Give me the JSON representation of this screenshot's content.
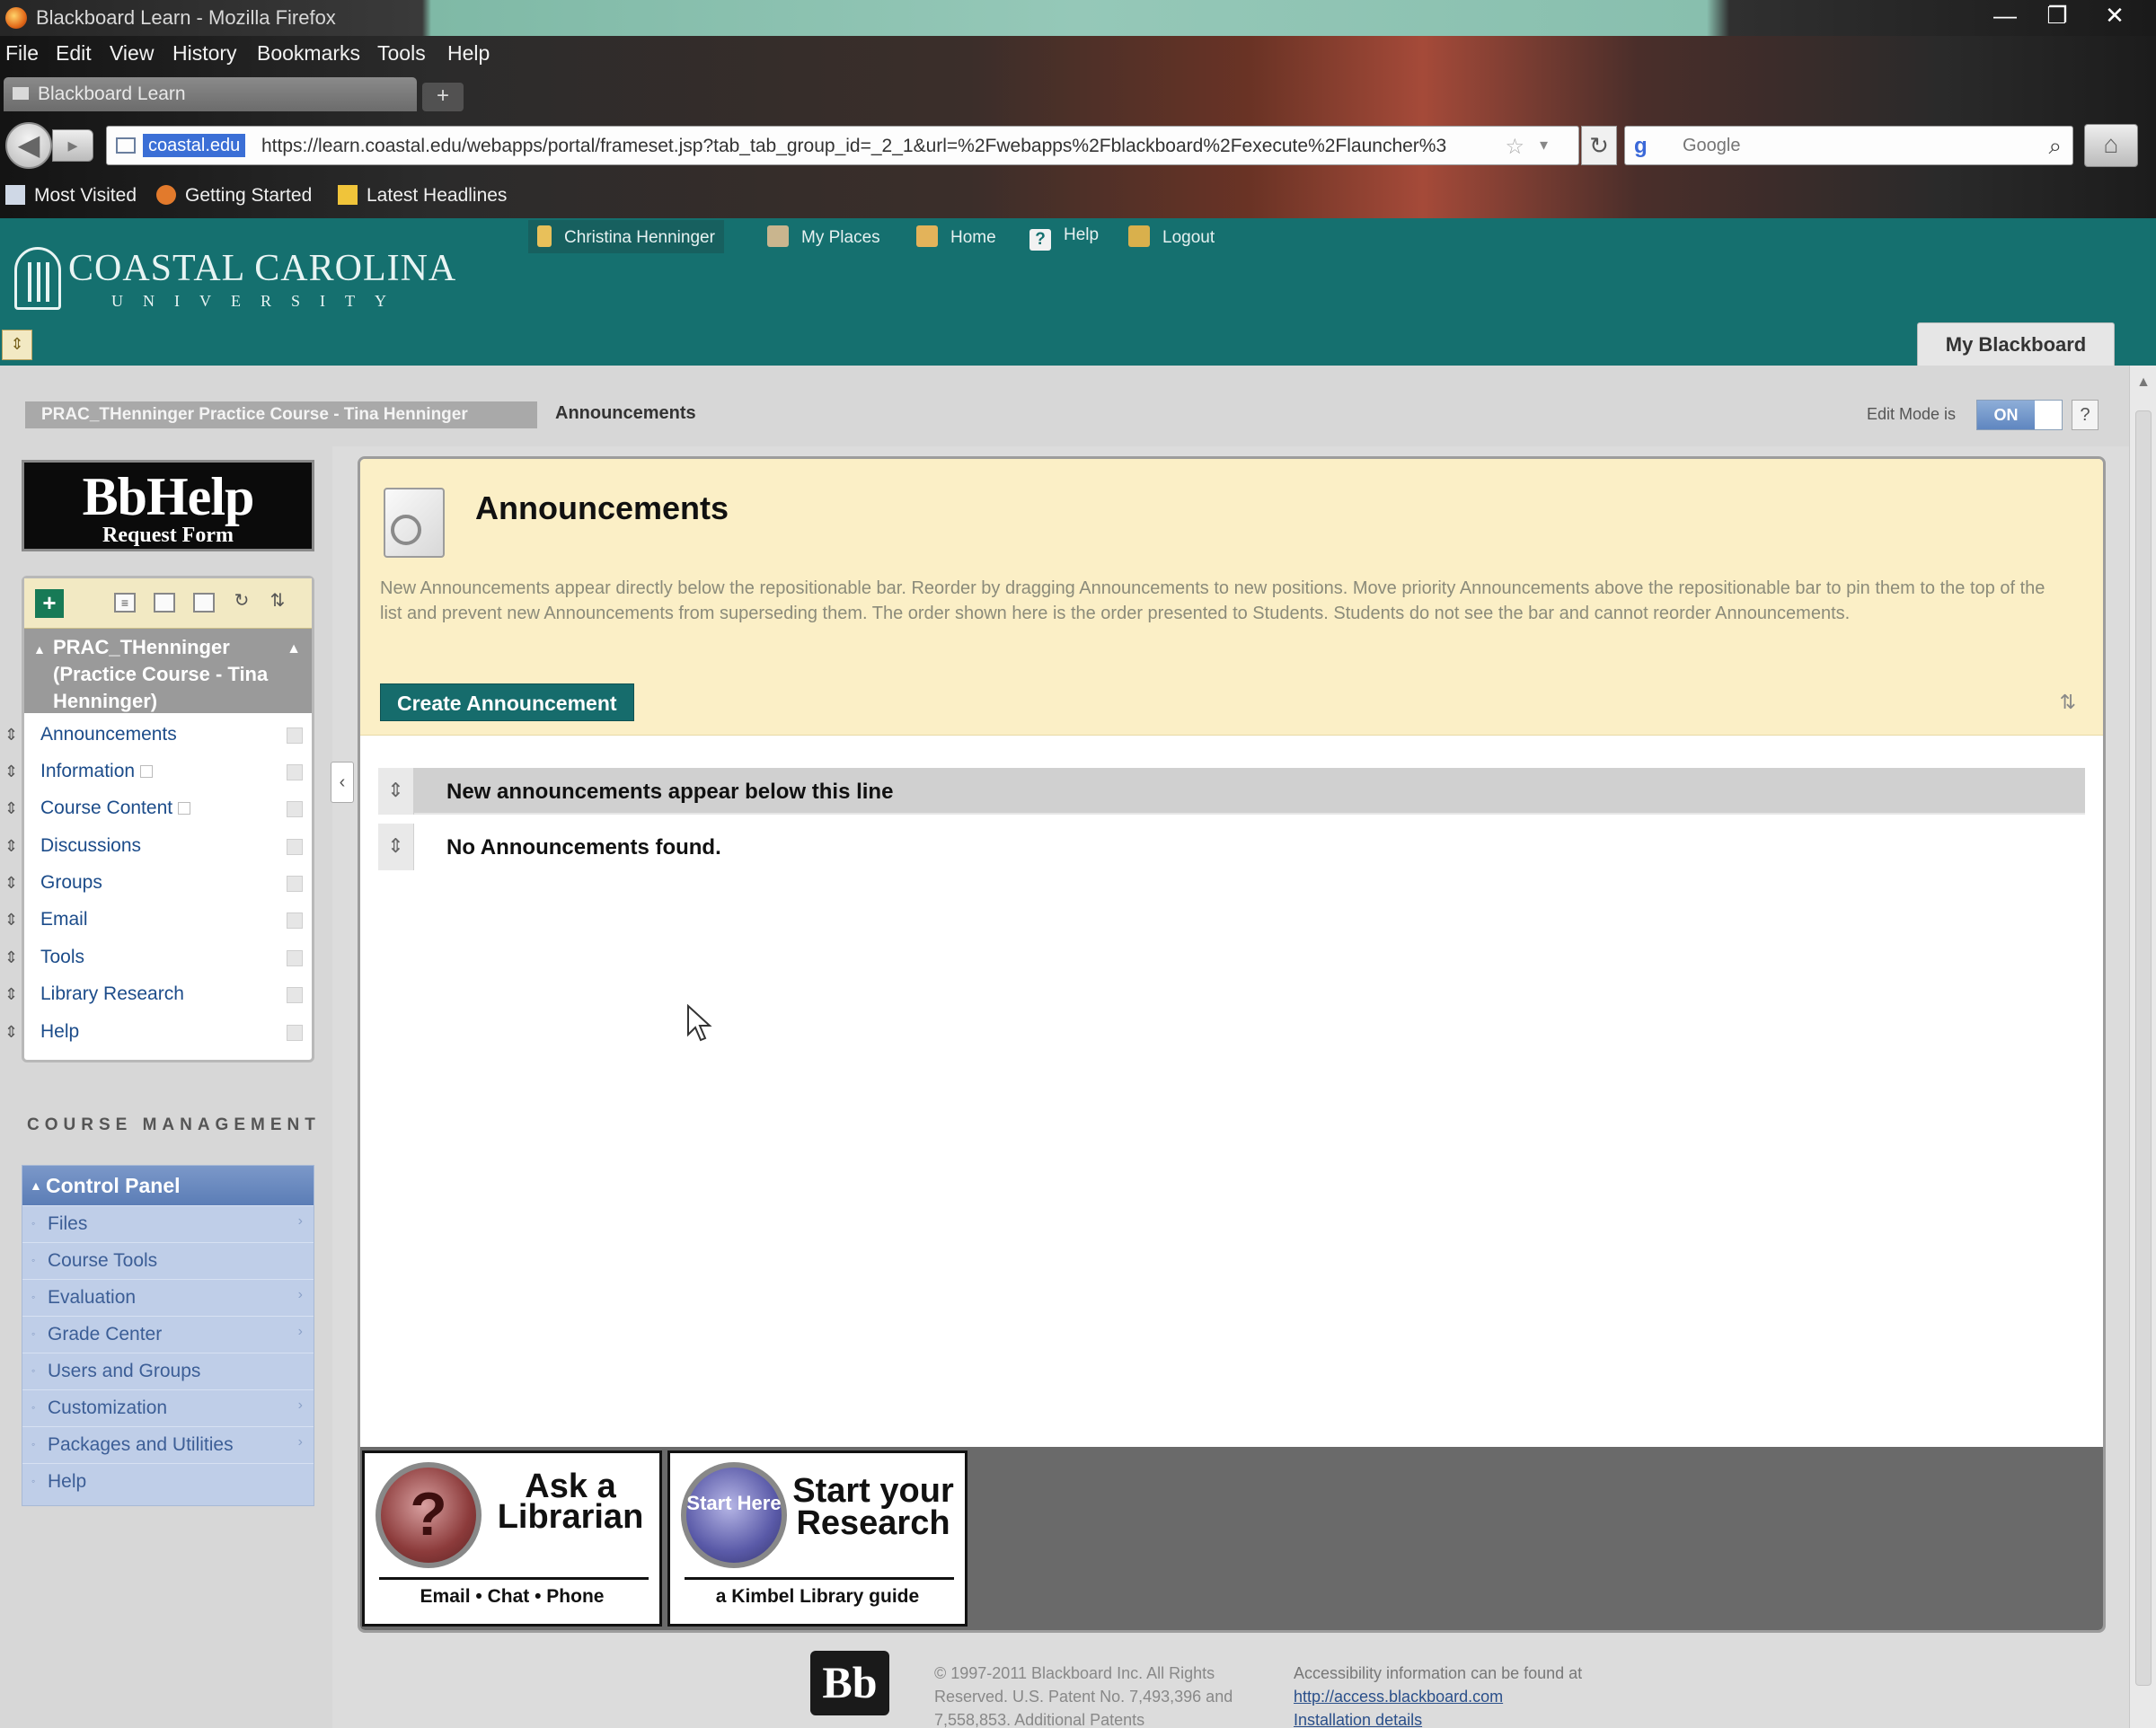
{
  "window": {
    "title": "Blackboard Learn - Mozilla Firefox",
    "controls": [
      "—",
      "❐",
      "✕"
    ]
  },
  "menubar": [
    "File",
    "Edit",
    "View",
    "History",
    "Bookmarks",
    "Tools",
    "Help"
  ],
  "tabs": [
    {
      "label": "Blackboard Learn"
    }
  ],
  "newtab_label": "+",
  "address": {
    "site": "coastal.edu",
    "url": "https://learn.coastal.edu/webapps/portal/frameset.jsp?tab_tab_group_id=_2_1&url=%2Fwebapps%2Fblackboard%2Fexecute%2Flauncher%3"
  },
  "search": {
    "engine_glyph": "g",
    "placeholder": "Google"
  },
  "bookmarks": [
    "Most Visited",
    "Getting Started",
    "Latest Headlines"
  ],
  "header": {
    "logo_name": "COASTAL CAROLINA",
    "logo_sub": "UNIVERSITY",
    "nav": [
      "Christina Henninger",
      "My Places",
      "Home",
      "Help",
      "Logout"
    ],
    "tab": "My Blackboard"
  },
  "breadcrumb": {
    "course": "PRAC_THenninger Practice Course - Tina Henninger",
    "page": "Announcements"
  },
  "edit_mode": {
    "label": "Edit Mode is",
    "state": "ON",
    "help": "?"
  },
  "bbhelp": {
    "big": "BbHelp",
    "small": "Request Form"
  },
  "course_menu": {
    "title": "PRAC_THenninger (Practice Course - Tina Henninger)",
    "items": [
      {
        "label": "Announcements"
      },
      {
        "label": "Information"
      },
      {
        "label": "Course Content"
      },
      {
        "label": "Discussions"
      },
      {
        "label": "Groups"
      },
      {
        "label": "Email"
      },
      {
        "label": "Tools"
      },
      {
        "label": "Library Research"
      },
      {
        "label": "Help"
      }
    ]
  },
  "course_management": {
    "label": "COURSE MANAGEMENT",
    "panel_title": "Control Panel",
    "items": [
      {
        "label": "Files"
      },
      {
        "label": "Course Tools"
      },
      {
        "label": "Evaluation"
      },
      {
        "label": "Grade Center"
      },
      {
        "label": "Users and Groups"
      },
      {
        "label": "Customization"
      },
      {
        "label": "Packages and Utilities"
      },
      {
        "label": "Help"
      }
    ]
  },
  "main": {
    "title": "Announcements",
    "description": "New Announcements appear directly below the repositionable bar. Reorder by dragging Announcements to new positions. Move priority Announcements above the repositionable bar to pin them to the top of the list and prevent new Announcements from superseding them. The order shown here is the order presented to Students. Students do not see the bar and cannot reorder Announcements.",
    "create_button": "Create Announcement",
    "repositionable_bar": "New announcements appear below this line",
    "empty_message": "No Announcements found."
  },
  "promos": [
    {
      "glyph": "?",
      "head": "Ask a Librarian",
      "foot": "Email • Chat • Phone"
    },
    {
      "glyph": "Start Here",
      "head": "Start your Research",
      "foot": "a Kimbel Library guide"
    }
  ],
  "footer": {
    "bb_logo": "Bb",
    "copyright": "© 1997-2011 Blackboard Inc. All Rights Reserved. U.S. Patent No. 7,493,396 and 7,558,853. Additional Patents",
    "accessibility": "Accessibility information can be found at",
    "accessibility_link": "http://access.blackboard.com",
    "install_link": "Installation details"
  },
  "colors": {
    "header": "#15706f",
    "accent_button": "#166c6c",
    "page_head_bg": "#fbefc6",
    "control_panel": "#5b7db6"
  }
}
